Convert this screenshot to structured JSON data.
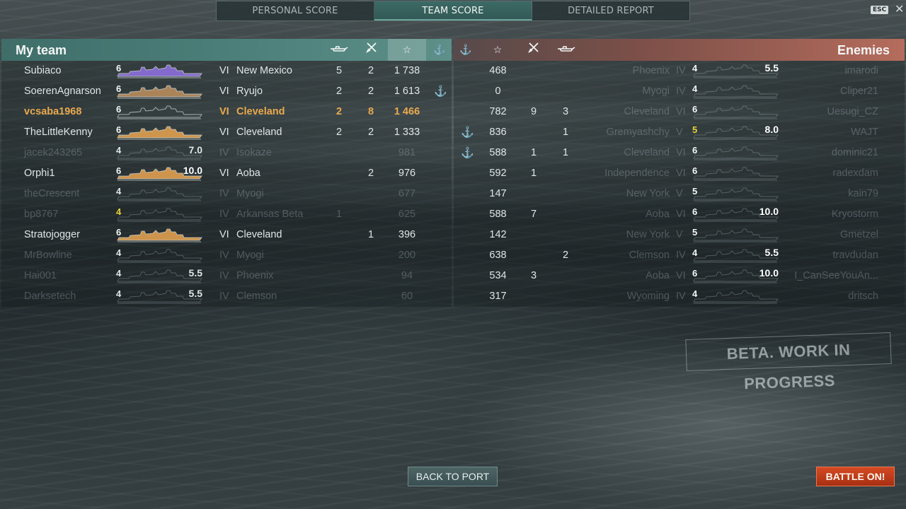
{
  "tabs": [
    {
      "label": "PERSONAL SCORE"
    },
    {
      "label": "TEAM SCORE"
    },
    {
      "label": "DETAILED REPORT"
    }
  ],
  "esc_label": "ESC",
  "close_label": "✕",
  "my_team": {
    "title": "My team",
    "icons": [
      "ships-destroyed-icon",
      "planes-destroyed-icon",
      "score-star-icon",
      "base-capture-anchor-icon"
    ],
    "rows": [
      {
        "name": "Subiaco",
        "tier_digit": "6",
        "tier": "VI",
        "ship": "New Mexico",
        "kills": "5",
        "planes": "2",
        "score": "1 738",
        "anchor": "",
        "multiplier": "",
        "silhouette_color": "#8c6fdc",
        "state": "alive"
      },
      {
        "name": "SoerenAgnarson",
        "tier_digit": "6",
        "tier": "VI",
        "ship": "Ryujo",
        "kills": "2",
        "planes": "2",
        "score": "1 613",
        "anchor": "⚓",
        "multiplier": "",
        "silhouette_color": "#b88d5c",
        "state": "alive"
      },
      {
        "name": "vcsaba1968",
        "tier_digit": "6",
        "tier": "VI",
        "ship": "Cleveland",
        "kills": "2",
        "planes": "8",
        "score": "1 466",
        "anchor": "",
        "multiplier": "",
        "silhouette_color": "",
        "state": "me"
      },
      {
        "name": "TheLittleKenny",
        "tier_digit": "6",
        "tier": "VI",
        "ship": "Cleveland",
        "kills": "2",
        "planes": "2",
        "score": "1 333",
        "anchor": "",
        "multiplier": "",
        "silhouette_color": "#e0a050",
        "state": "alive"
      },
      {
        "name": "jacek243265",
        "tier_digit": "4",
        "tier": "IV",
        "ship": "Isokaze",
        "kills": "",
        "planes": "",
        "score": "981",
        "anchor": "",
        "multiplier": "7.0",
        "silhouette_color": "",
        "state": "dead"
      },
      {
        "name": "Orphi1",
        "tier_digit": "6",
        "tier": "VI",
        "ship": "Aoba",
        "kills": "",
        "planes": "2",
        "score": "976",
        "anchor": "",
        "multiplier": "10.0",
        "silhouette_color": "#e0a050",
        "state": "alive"
      },
      {
        "name": "theCrescent",
        "tier_digit": "4",
        "tier": "IV",
        "ship": "Myogi",
        "kills": "",
        "planes": "",
        "score": "677",
        "anchor": "",
        "multiplier": "",
        "silhouette_color": "",
        "state": "dead"
      },
      {
        "name": "bp8767",
        "tier_digit": "4",
        "tier": "IV",
        "ship": "Arkansas Beta",
        "kills": "1",
        "planes": "",
        "score": "625",
        "anchor": "",
        "multiplier": "",
        "silhouette_color": "",
        "state": "dead",
        "gold_digit": true
      },
      {
        "name": "Stratojogger",
        "tier_digit": "6",
        "tier": "VI",
        "ship": "Cleveland",
        "kills": "",
        "planes": "1",
        "score": "396",
        "anchor": "",
        "multiplier": "",
        "silhouette_color": "#e0a050",
        "state": "alive"
      },
      {
        "name": "MrBowline",
        "tier_digit": "4",
        "tier": "IV",
        "ship": "Myogi",
        "kills": "",
        "planes": "",
        "score": "200",
        "anchor": "",
        "multiplier": "",
        "silhouette_color": "",
        "state": "dead"
      },
      {
        "name": "Hai001",
        "tier_digit": "4",
        "tier": "IV",
        "ship": "Phoenix",
        "kills": "",
        "planes": "",
        "score": "94",
        "anchor": "",
        "multiplier": "5.5",
        "silhouette_color": "",
        "state": "dead"
      },
      {
        "name": "Darksetech",
        "tier_digit": "4",
        "tier": "IV",
        "ship": "Clemson",
        "kills": "",
        "planes": "",
        "score": "60",
        "anchor": "",
        "multiplier": "5.5",
        "silhouette_color": "",
        "state": "dead"
      }
    ]
  },
  "enemies": {
    "title": "Enemies",
    "icons": [
      "base-capture-anchor-icon",
      "score-star-icon",
      "planes-destroyed-icon",
      "ships-destroyed-icon"
    ],
    "rows": [
      {
        "name": "imarodi",
        "tier_digit": "4",
        "tier": "IV",
        "ship": "Phoenix",
        "kills": "",
        "planes": "",
        "score": "468",
        "anchor": "",
        "multiplier": "5.5"
      },
      {
        "name": "Cliper21",
        "tier_digit": "4",
        "tier": "IV",
        "ship": "Myogi",
        "kills": "",
        "planes": "",
        "score": "0",
        "anchor": "",
        "multiplier": ""
      },
      {
        "name": "Uesugi_CZ",
        "tier_digit": "6",
        "tier": "VI",
        "ship": "Cleveland",
        "kills": "3",
        "planes": "9",
        "score": "782",
        "anchor": "",
        "multiplier": ""
      },
      {
        "name": "WAJT",
        "tier_digit": "5",
        "tier": "V",
        "ship": "Gremyashchy",
        "kills": "1",
        "planes": "",
        "score": "836",
        "anchor": "⚓",
        "multiplier": "8.0",
        "gold_digit": true
      },
      {
        "name": "dominic21",
        "tier_digit": "6",
        "tier": "VI",
        "ship": "Cleveland",
        "kills": "1",
        "planes": "1",
        "score": "588",
        "anchor": "⚓",
        "multiplier": ""
      },
      {
        "name": "radexdam",
        "tier_digit": "6",
        "tier": "VI",
        "ship": "Independence",
        "kills": "",
        "planes": "1",
        "score": "592",
        "anchor": "",
        "multiplier": ""
      },
      {
        "name": "kain79",
        "tier_digit": "5",
        "tier": "V",
        "ship": "New York",
        "kills": "",
        "planes": "",
        "score": "147",
        "anchor": "",
        "multiplier": ""
      },
      {
        "name": "Kryostorm",
        "tier_digit": "6",
        "tier": "VI",
        "ship": "Aoba",
        "kills": "",
        "planes": "7",
        "score": "588",
        "anchor": "",
        "multiplier": "10.0"
      },
      {
        "name": "Gmetzel",
        "tier_digit": "5",
        "tier": "V",
        "ship": "New York",
        "kills": "",
        "planes": "",
        "score": "142",
        "anchor": "",
        "multiplier": ""
      },
      {
        "name": "travdudan",
        "tier_digit": "4",
        "tier": "IV",
        "ship": "Clemson",
        "kills": "2",
        "planes": "",
        "score": "638",
        "anchor": "",
        "multiplier": "5.5"
      },
      {
        "name": "I_CanSeeYouAn...",
        "tier_digit": "6",
        "tier": "VI",
        "ship": "Aoba",
        "kills": "",
        "planes": "3",
        "score": "534",
        "anchor": "",
        "multiplier": "10.0"
      },
      {
        "name": "dritsch",
        "tier_digit": "4",
        "tier": "IV",
        "ship": "Wyoming",
        "kills": "",
        "planes": "",
        "score": "317",
        "anchor": "",
        "multiplier": ""
      }
    ]
  },
  "watermark": "BETA. WORK IN PROGRESS",
  "buttons": {
    "back": "BACK TO PORT",
    "battle": "BATTLE ON!"
  }
}
